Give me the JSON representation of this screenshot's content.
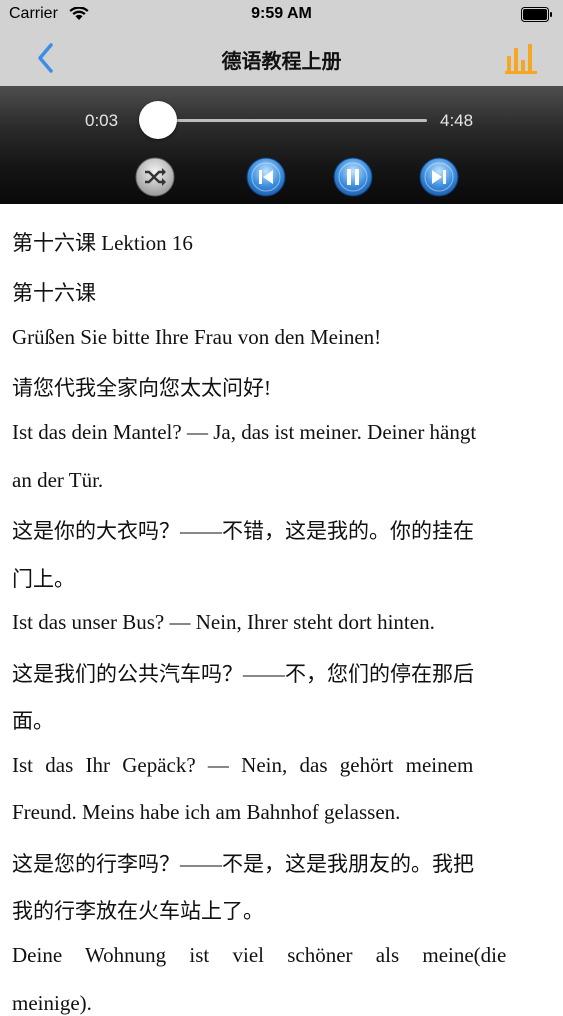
{
  "status_bar": {
    "carrier": "Carrier",
    "time": "9:59 AM"
  },
  "nav": {
    "title": "德语教程上册"
  },
  "player": {
    "current_time": "0:03",
    "total_time": "4:48",
    "progress_fraction": 0.01
  },
  "colors": {
    "accent_blue": "#3a8ee6",
    "accent_orange": "#f5a623"
  },
  "lines": [
    "第十六课 Lektion 16",
    "第十六课",
    "Grüßen Sie bitte Ihre Frau von den Meinen!",
    "请您代我全家向您太太问好!",
    "Ist das dein Mantel? — Ja, das ist meiner. Deiner hängt",
    "an der Tür.",
    "这是你的大衣吗？——不错，这是我的。你的挂在",
    "门上。",
    "Ist das unser Bus? — Nein, Ihrer steht dort hinten.",
    "这是我们的公共汽车吗？——不，您们的停在那后",
    "面。",
    "Ist das Ihr Gepäck? — Nein, das gehört meinem",
    "Freund. Meins habe ich am Bahnhof gelassen.",
    "这是您的行李吗？——不是，这是我朋友的。我把",
    "我的行李放在火车站上了。",
    "Deine Wohnung ist viel schöner als meine(die",
    "meinige)."
  ]
}
